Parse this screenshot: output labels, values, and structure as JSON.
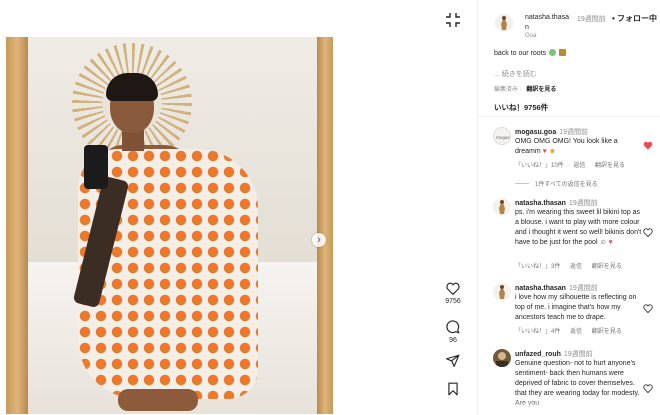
{
  "post": {
    "author": "natasha.thasa",
    "author_wrap": "n",
    "time": "19週間前",
    "follow_state": "• フォロー中",
    "location": "Goa",
    "caption": "back to our roots",
    "read_more": "... 続きを読む",
    "edited": "編集済み",
    "view_translation": "翻訳を見る",
    "likes": "いいね！9756件"
  },
  "actions": {
    "like_count": "9756",
    "comment_count": "96"
  },
  "comments": [
    {
      "user": "mogasu.goa",
      "time": "19週間前",
      "text": "OMG OMG OMG! You look like a dreamm",
      "likes": "「いいね！」10件",
      "reply": "返信",
      "translate": "翻訳を見る",
      "view_replies": "1件すべての返信を見る",
      "liked": true
    },
    {
      "user": "natasha.thasan",
      "time": "19週間前",
      "text": "ps. i'm wearing this sweet lil bikini top as a blouse. i want to play with more colour and i thought it went so well! bikinis don't have to be just for the pool ☺",
      "likes": "「いいね！」3件",
      "reply": "返信",
      "translate": "翻訳を見る",
      "liked": false
    },
    {
      "user": "natasha.thasan",
      "time": "19週間前",
      "text": "i love how my silhouette is reflecting on top of me. i imagine that's how my ancestors teach me to drape.",
      "likes": "「いいね！」4件",
      "reply": "返信",
      "translate": "翻訳を見る",
      "liked": false
    },
    {
      "user": "unfazed_rouh",
      "time": "19週間前",
      "text": "Genuine question- not to hurt anyone's sentiment- back then humans were deprived of fabric to cover themselves. that they are wearing today for modesty. Are you",
      "liked": false
    }
  ],
  "colors": {
    "accent_red": "#ed4956",
    "muted": "#8e8e8e",
    "text": "#262626",
    "saree_orange": "#ec7a2c"
  },
  "icons": [
    "shrink-icon",
    "next-arrow-icon",
    "heart-icon",
    "comment-icon",
    "share-icon",
    "bookmark-icon"
  ]
}
